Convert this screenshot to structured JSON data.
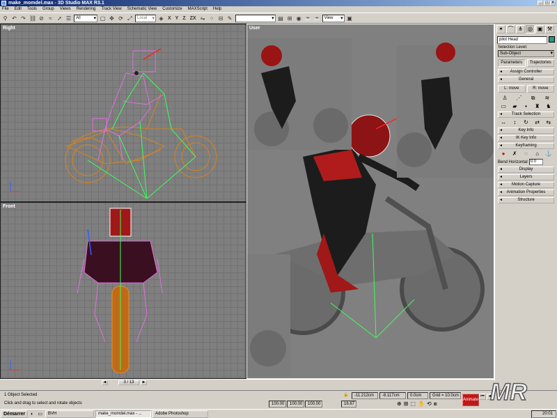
{
  "window": {
    "title": "make_momdel.max - 3D Studio MAX R3.1",
    "buttons": [
      "_",
      "□",
      "×"
    ]
  },
  "menu": [
    "File",
    "Edit",
    "Tools",
    "Group",
    "Views",
    "Rendering",
    "Track View",
    "Schematic View",
    "Customize",
    "MAXScript",
    "Help"
  ],
  "toolbar": {
    "selection_filter": "All",
    "coord_system": "Local",
    "axis_x": "X",
    "axis_y": "Y",
    "axis_z": "Z",
    "axis_zx": "ZX",
    "named_selection": "",
    "view_dropdown": "View"
  },
  "viewports": {
    "right": {
      "label": "Right"
    },
    "front": {
      "label": "Front"
    },
    "user": {
      "label": "User"
    }
  },
  "time_slider": {
    "frame": "3 / 13"
  },
  "command_panel": {
    "tab_icons": [
      "create-icon",
      "modify-icon",
      "hierarchy-icon",
      "motion-icon",
      "display-icon",
      "utilities-icon"
    ],
    "object_name": "pilot Head",
    "object_color": "#1f9a82",
    "selection_level_label": "Selection Level:",
    "selection_level_value": "Sub-Object",
    "parameters_btn": "Parameters",
    "trajectories_btn": "Trajectories",
    "assign_controller": "Assign Controller",
    "general": "General",
    "l_move": "L: move",
    "r_move": "R: move",
    "track_selection": "Track Selection",
    "key_info": "Key Info",
    "ik_key_info": "IK Key Info",
    "keyframing": "Keyframing",
    "bend_horizontal_label": "Bend Horizontal",
    "bend_horizontal_value": "0.0",
    "display": "Display",
    "layers": "Layers",
    "motion_capture": "Motion Capture",
    "animation_properties": "Animation Properties",
    "structure": "Structure"
  },
  "status_bar": {
    "selected": "1 Object Selected",
    "prompt": "Click and drag to select and rotate objects",
    "x": "-11.212cm",
    "y": "-8.117cm",
    "z": "0.0cm",
    "grid": "Grid = 10.0cm",
    "f1": "100.00",
    "f2": "100.00",
    "f3": "100.00",
    "f4": "16.67",
    "animate": "Animate"
  },
  "logo": {
    "text": "MR"
  },
  "taskbar": {
    "start": "Démarrer",
    "tasks": [
      "BVH",
      "make_momdel.max - ...",
      "Adobe Photoshop"
    ],
    "clock": "20:01"
  }
}
